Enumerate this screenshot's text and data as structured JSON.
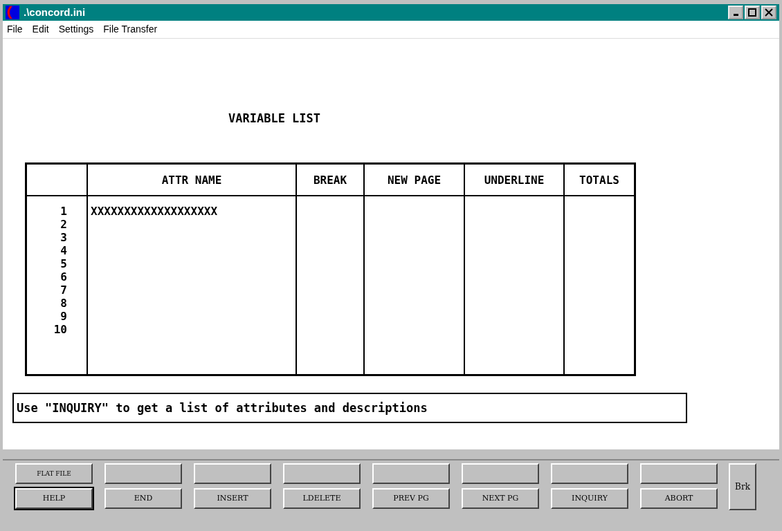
{
  "window": {
    "title": ".\\concord.ini"
  },
  "menu": [
    "File",
    "Edit",
    "Settings",
    "File Transfer"
  ],
  "screen_title": "VARIABLE LIST",
  "table": {
    "columns": [
      "",
      "ATTR NAME",
      "BREAK",
      "NEW PAGE",
      "UNDERLINE",
      "TOTALS"
    ],
    "rows": [
      {
        "number": "1",
        "attr_name": "XXXXXXXXXXXXXXXXXXX"
      },
      {
        "number": "2"
      },
      {
        "number": "3"
      },
      {
        "number": "4"
      },
      {
        "number": "5"
      },
      {
        "number": "6"
      },
      {
        "number": "7"
      },
      {
        "number": "8"
      },
      {
        "number": "9"
      },
      {
        "number": "10"
      }
    ]
  },
  "message": "Use \"INQUIRY\" to get a list of attributes and descriptions",
  "function_keys": {
    "top": [
      "FLAT FILE"
    ],
    "bottom": [
      {
        "label": "HELP",
        "selected": true
      },
      {
        "label": "END",
        "selected": false
      },
      {
        "label": "INSERT",
        "selected": false
      },
      {
        "label": "LDELETE",
        "selected": false
      },
      {
        "label": "PREV PG",
        "selected": false
      },
      {
        "label": "NEXT PG",
        "selected": false
      },
      {
        "label": "INQUIRY",
        "selected": false
      },
      {
        "label": "ABORT",
        "selected": false
      }
    ],
    "side": "Brk"
  }
}
